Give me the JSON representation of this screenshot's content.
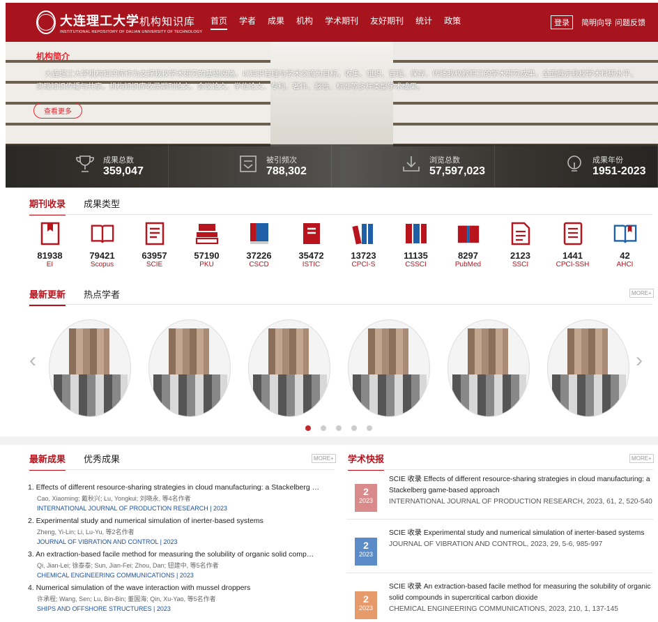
{
  "header": {
    "logo_cn": "大连理工大学",
    "logo_cn_sub": "机构知识库",
    "logo_en": "INSTITUTIONAL REPOSITORY OF DALIAN UNIVERSITY OF TECHNOLOGY",
    "nav": [
      "首页",
      "学者",
      "成果",
      "机构",
      "学术期刊",
      "友好期刊",
      "统计",
      "政策"
    ],
    "login": "登录",
    "guide": "简明向导",
    "feedback": "问题反馈"
  },
  "banner": {
    "title": "机构简介",
    "body": "大连理工大学机构知识库作为支撑我校学术研究的基础设施，以知识管理与学术交流为目标，收集、组织、管理、保存、传播我校教职工的学术研究成果，全面展示我校学术科研水平，实现知识传播与共享。机构知识库收录期刊论文、会议论文、学位论文、专利、著作、报告、标准等多种类型学术成果。",
    "more": "查看更多",
    "stats": [
      {
        "label": "成果总数",
        "value": "359,047",
        "icon": "trophy-icon"
      },
      {
        "label": "被引频次",
        "value": "788,302",
        "icon": "citation-icon"
      },
      {
        "label": "浏览总数",
        "value": "57,597,023",
        "icon": "download-icon"
      },
      {
        "label": "成果年份",
        "value": "1951-2023",
        "icon": "lightbulb-icon"
      }
    ]
  },
  "index_tabs": [
    "期刊收录",
    "成果类型"
  ],
  "indexes": [
    {
      "count": "81938",
      "name": "EI"
    },
    {
      "count": "79421",
      "name": "Scopus"
    },
    {
      "count": "63957",
      "name": "SCIE"
    },
    {
      "count": "57190",
      "name": "PKU"
    },
    {
      "count": "37226",
      "name": "CSCD"
    },
    {
      "count": "35472",
      "name": "ISTIC"
    },
    {
      "count": "13723",
      "name": "CPCI-S"
    },
    {
      "count": "11135",
      "name": "CSSCI"
    },
    {
      "count": "8297",
      "name": "PubMed"
    },
    {
      "count": "2123",
      "name": "SSCI"
    },
    {
      "count": "1441",
      "name": "CPCI-SSH"
    },
    {
      "count": "42",
      "name": "AHCI"
    }
  ],
  "scholar_tabs": [
    "最新更新",
    "热点学者"
  ],
  "more_label": "MORE+",
  "result_tabs": [
    "最新成果",
    "优秀成果"
  ],
  "results": [
    {
      "title": "1. Effects of different resource-sharing strategies in cloud manufacturing: a Stackelberg …",
      "authors": "Cao, Xiaoming; 戴秋兴; Lu, Yongkui; 刘晓永, 等4名作者",
      "journal": "INTERNATIONAL JOURNAL OF PRODUCTION RESEARCH | 2023"
    },
    {
      "title": "2. Experimental study and numerical simulation of inerter-based systems",
      "authors": "Zheng, Yi-Lin; Li, Lu-Yu, 等2名作者",
      "journal": "JOURNAL OF VIBRATION AND CONTROL | 2023"
    },
    {
      "title": "3. An extraction-based facile method for measuring the solubility of organic solid comp…",
      "authors": "Qi, Jian-Lei; 徐泰泰; Sun, Jian-Fei; Zhou, Dan; 钮建中, 等5名作者",
      "journal": "CHEMICAL ENGINEERING COMMUNICATIONS | 2023"
    },
    {
      "title": "4. Numerical simulation of the wave interaction with mussel droppers",
      "authors": "许承程; Wang, Sen; Lu, Bin-Bin; 董国海; Qin, Xu-Yao, 等5名作者",
      "journal": "SHIPS AND OFFSHORE STRUCTURES | 2023"
    }
  ],
  "flash_title": "学术快报",
  "flash": [
    {
      "num": "2",
      "year": "2023",
      "color": "#d98a8a",
      "text": "SCIE 收录 Effects of different resource-sharing strategies in cloud manufacturing: a Stackelberg game-based approach",
      "journal": "INTERNATIONAL JOURNAL OF PRODUCTION RESEARCH, 2023, 61, 2, 520-540"
    },
    {
      "num": "2",
      "year": "2023",
      "color": "#5b8cc7",
      "text": "SCIE 收录 Experimental study and numerical simulation of inerter-based systems",
      "journal": "JOURNAL OF VIBRATION AND CONTROL, 2023, 29, 5-6, 985-997"
    },
    {
      "num": "2",
      "year": "2023",
      "color": "#e79a6a",
      "text": "SCIE 收录 An extraction-based facile method for measuring the solubility of organic solid compounds in supercritical carbon dioxide",
      "journal": "CHEMICAL ENGINEERING COMMUNICATIONS, 2023, 210, 1, 137-145"
    }
  ]
}
